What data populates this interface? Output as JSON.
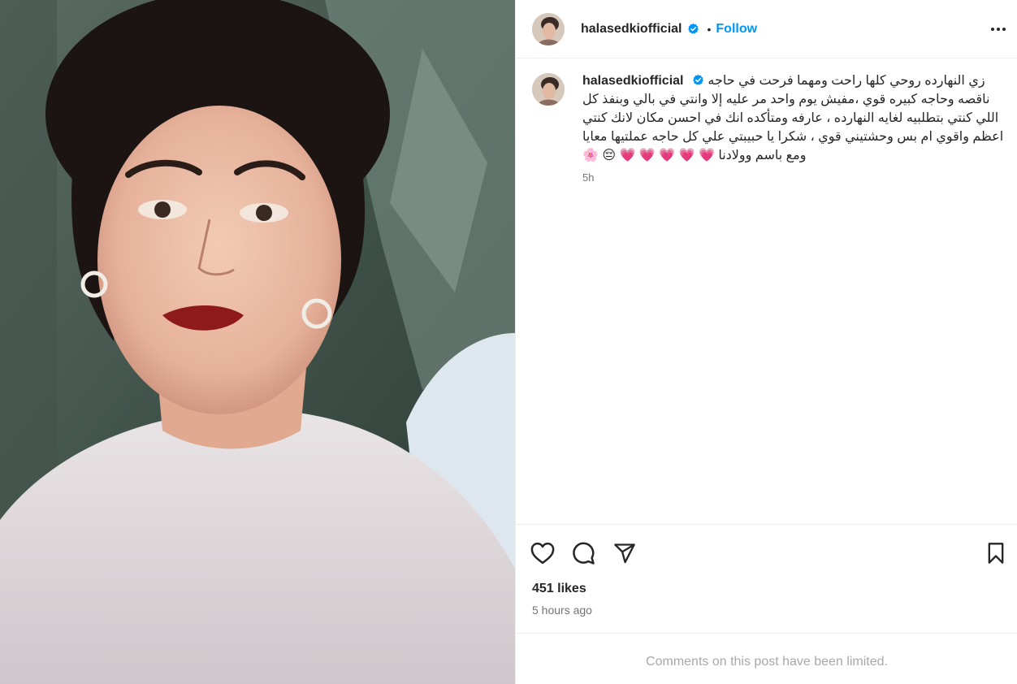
{
  "post": {
    "username": "halasedkiofficial",
    "follow_label": "Follow",
    "separator": "•",
    "caption": "زي النهارده روحي كلها راحت ومهما فرحت في حاجه ناقصه وحاجه كبيره قوي ،مفيش يوم واحد مر عليه إلا وانتي في بالي وبنفذ كل اللي كنتي بتطلبيه لغايه النهارده ، عارفه ومتأكده انك في احسن مكان لانك كنتي اعظم واقوي ام بس وحشتيني قوي ، شكرا يا حبيبتي علي كل حاجه عملتيها معايا ومع باسم وولادنا 💗 💗 💗 💗 💗 😔 🌸",
    "relative_time": "5h",
    "likes": "451 likes",
    "posted_ago": "5 hours ago",
    "comments_limited": "Comments on this post have been limited."
  },
  "icons": {
    "verified": "verified-badge-icon",
    "more": "more-options-icon",
    "like": "heart-icon",
    "comment": "comment-icon",
    "share": "share-icon",
    "save": "bookmark-icon"
  },
  "colors": {
    "accent": "#0095f6",
    "text": "#262626",
    "muted": "#737373",
    "limited": "#a8a8a8",
    "divider": "#efefef"
  }
}
